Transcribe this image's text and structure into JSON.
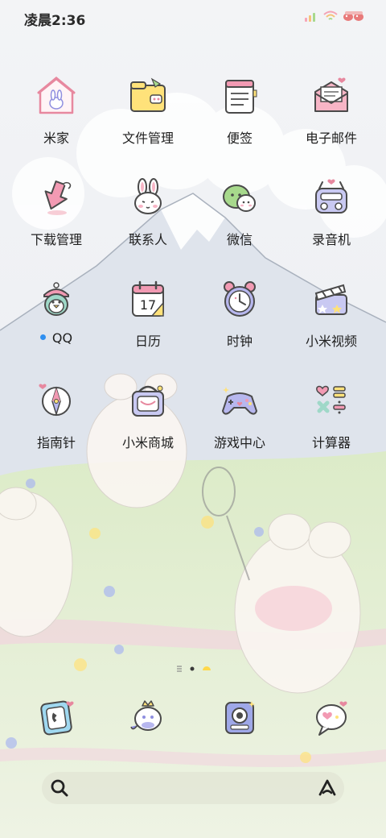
{
  "status_bar": {
    "time": "凌晨2:36",
    "signal_icon": "signal-bars-icon",
    "wifi_icon": "wifi-icon",
    "battery_icon": "battery-cartoon-icon"
  },
  "apps": [
    {
      "label": "米家",
      "icon": "home-bunny-icon"
    },
    {
      "label": "文件管理",
      "icon": "folder-icon"
    },
    {
      "label": "便签",
      "icon": "notepad-icon"
    },
    {
      "label": "电子邮件",
      "icon": "envelope-icon"
    },
    {
      "label": "下载管理",
      "icon": "download-arrow-icon"
    },
    {
      "label": "联系人",
      "icon": "bunny-face-icon"
    },
    {
      "label": "微信",
      "icon": "chat-bubbles-icon"
    },
    {
      "label": "录音机",
      "icon": "recorder-icon"
    },
    {
      "label": "QQ",
      "icon": "penguin-icon",
      "has_update_dot": true
    },
    {
      "label": "日历",
      "icon": "calendar-icon",
      "calendar_day": "17"
    },
    {
      "label": "时钟",
      "icon": "alarm-clock-icon"
    },
    {
      "label": "小米视频",
      "icon": "clapperboard-icon"
    },
    {
      "label": "指南针",
      "icon": "compass-icon"
    },
    {
      "label": "小米商城",
      "icon": "shopping-basket-icon"
    },
    {
      "label": "游戏中心",
      "icon": "gamepad-icon"
    },
    {
      "label": "计算器",
      "icon": "calculator-symbols-icon"
    }
  ],
  "page_indicator": {
    "pages": 3,
    "current_page": 2
  },
  "dock": [
    {
      "icon": "phone-icon"
    },
    {
      "icon": "message-crown-icon"
    },
    {
      "icon": "camera-icon"
    },
    {
      "icon": "chat-heart-bubble-icon"
    }
  ],
  "search_bar": {
    "search_icon": "search-icon",
    "voice_icon": "voice-assistant-icon"
  },
  "colors": {
    "label_text": "#1f1f1f",
    "badge_blue": "#2f8ff0",
    "icon_pink": "#f29ab3",
    "icon_yellow": "#ffe27a",
    "icon_purple": "#8f8fe0",
    "meadow_green": "#cfe6b0"
  }
}
